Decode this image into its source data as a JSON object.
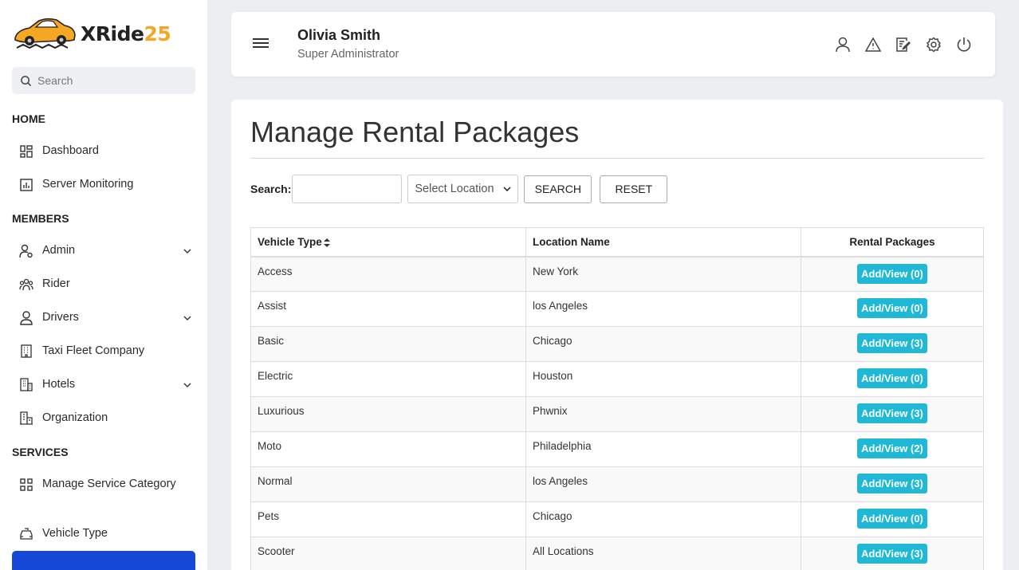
{
  "brand": {
    "name_prefix": "XRide",
    "name_suffix": "25",
    "accent": "#f5a623"
  },
  "search": {
    "placeholder": "Search"
  },
  "sidebar": {
    "sections": [
      {
        "title": "HOME"
      },
      {
        "title": "MEMBERS"
      },
      {
        "title": "SERVICES"
      }
    ],
    "items": [
      {
        "label": "Dashboard",
        "icon": "grid-icon"
      },
      {
        "label": "Server Monitoring",
        "icon": "chart-icon"
      },
      {
        "label": "Admin",
        "icon": "user-gear-icon",
        "expandable": true
      },
      {
        "label": "Rider",
        "icon": "users-icon"
      },
      {
        "label": "Drivers",
        "icon": "driver-icon",
        "expandable": true
      },
      {
        "label": "Taxi Fleet Company",
        "icon": "building-icon"
      },
      {
        "label": "Hotels",
        "icon": "hotel-icon",
        "expandable": true
      },
      {
        "label": "Organization",
        "icon": "organization-icon"
      },
      {
        "label": "Manage Service Category",
        "icon": "category-icon"
      },
      {
        "label": "Vehicle Type",
        "icon": "taxi-icon"
      }
    ],
    "active_color": "#1648d8"
  },
  "header": {
    "user_name": "Olivia Smith",
    "user_role": "Super Administrator"
  },
  "page": {
    "title": "Manage Rental Packages",
    "filter_label": "Search:",
    "location_select": "Select Location",
    "search_button": "SEARCH",
    "reset_button": "RESET"
  },
  "table": {
    "columns": [
      "Vehicle Type",
      "Location Name",
      "Rental Packages"
    ],
    "rows": [
      {
        "vehicle": "Access",
        "location": "New York",
        "action": "Add/View (0)"
      },
      {
        "vehicle": "Assist",
        "location": "los Angeles",
        "action": "Add/View (0)"
      },
      {
        "vehicle": "Basic",
        "location": "Chicago",
        "action": "Add/View (3)"
      },
      {
        "vehicle": "Electric",
        "location": "Houston",
        "action": "Add/View (0)"
      },
      {
        "vehicle": "Luxurious",
        "location": "Phwnix",
        "action": "Add/View (3)"
      },
      {
        "vehicle": "Moto",
        "location": "Philadelphia",
        "action": "Add/View (2)"
      },
      {
        "vehicle": "Normal",
        "location": "los Angeles",
        "action": "Add/View (3)"
      },
      {
        "vehicle": "Pets",
        "location": "Chicago",
        "action": "Add/View (0)"
      },
      {
        "vehicle": "Scooter",
        "location": "All Locations",
        "action": "Add/View (3)"
      }
    ],
    "button_color": "#1fb8d7"
  }
}
